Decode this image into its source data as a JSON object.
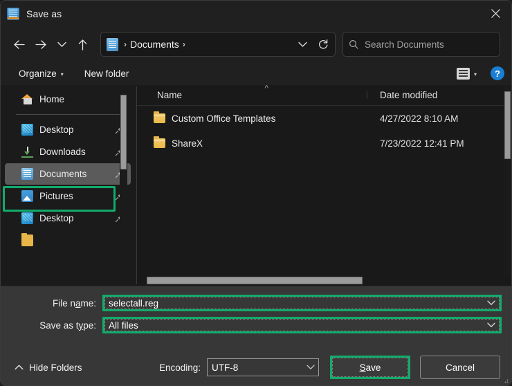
{
  "window": {
    "title": "Save as",
    "icon": "document-icon",
    "close_label": "✕"
  },
  "nav": {
    "back_icon": "arrow-left-icon",
    "forward_icon": "arrow-right-icon",
    "recent_icon": "chevron-down-icon",
    "up_icon": "arrow-up-icon",
    "refresh_icon": "refresh-icon",
    "dropdown_icon": "chevron-down-icon"
  },
  "address": {
    "icon": "documents-folder-icon",
    "separator_start": "›",
    "crumb": "Documents",
    "separator_end": "›"
  },
  "search": {
    "placeholder": "Search Documents",
    "value": "",
    "icon": "search-icon"
  },
  "commandbar": {
    "organize": "Organize",
    "organize_caret": "▾",
    "new_folder": "New folder",
    "view_icon": "list-view-icon",
    "view_caret": "▾",
    "help_label": "?"
  },
  "sidebar": {
    "items": [
      {
        "label": "Home",
        "icon": "home-icon",
        "pinned": false,
        "selected": false,
        "separator_after": true
      },
      {
        "label": "Desktop",
        "icon": "desktop-icon",
        "pinned": true,
        "selected": false
      },
      {
        "label": "Downloads",
        "icon": "downloads-icon",
        "pinned": true,
        "selected": false
      },
      {
        "label": "Documents",
        "icon": "documents-icon",
        "pinned": true,
        "selected": true
      },
      {
        "label": "Pictures",
        "icon": "pictures-icon",
        "pinned": true,
        "selected": false
      },
      {
        "label": "Desktop",
        "icon": "desktop-icon",
        "pinned": true,
        "selected": false
      },
      {
        "label": "",
        "icon": "folder-icon",
        "pinned": false,
        "selected": false
      }
    ],
    "pin_icon": "pin-icon"
  },
  "filelist": {
    "sort_indicator": "˄",
    "columns": [
      "Name",
      "Date modified"
    ],
    "rows": [
      {
        "name": "Custom Office Templates",
        "date": "4/27/2022 8:10 AM",
        "icon": "folder-icon"
      },
      {
        "name": "ShareX",
        "date": "7/23/2022 12:41 PM",
        "icon": "folder-icon"
      }
    ]
  },
  "form": {
    "file_name_label_pre": "File n",
    "file_name_label_underline": "a",
    "file_name_label_post": "me:",
    "file_name_value": "selectall.reg",
    "save_type_label_pre": "Save as t",
    "save_type_label_underline": "y",
    "save_type_label_post": "pe:",
    "save_type_value": "All files",
    "dropdown_icon": "chevron-down-icon"
  },
  "footer": {
    "hide_folders": "Hide Folders",
    "hide_folders_icon": "chevron-up-icon",
    "encoding_label": "Encoding:",
    "encoding_value": "UTF-8",
    "encoding_icon": "chevron-down-icon",
    "save_label_pre": "",
    "save_label_underline": "S",
    "save_label_post": "ave",
    "cancel_label": "Cancel",
    "resize_grip": "resize-grip-icon"
  },
  "colors": {
    "highlight_green": "#12ab6c",
    "selection_gray": "#5b5b5b",
    "window_bg": "#202020",
    "form_bg": "#373737",
    "help_blue": "#1a7fd4"
  }
}
